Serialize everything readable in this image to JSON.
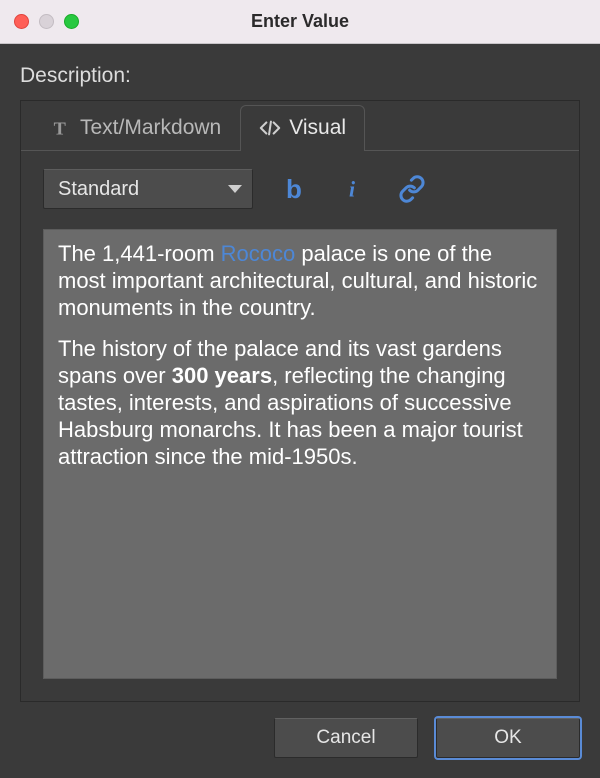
{
  "window": {
    "title": "Enter Value"
  },
  "form": {
    "label": "Description:"
  },
  "tabs": [
    {
      "id": "text",
      "label": "Text/Markdown",
      "active": false
    },
    {
      "id": "visual",
      "label": "Visual",
      "active": true
    }
  ],
  "toolbar": {
    "style_select": {
      "value": "Standard"
    },
    "buttons": [
      {
        "id": "bold",
        "glyph": "b"
      },
      {
        "id": "italic",
        "glyph": "i"
      },
      {
        "id": "link",
        "glyph": "link"
      }
    ]
  },
  "editor": {
    "paragraphs": [
      {
        "runs": [
          {
            "text": "The 1,441-room "
          },
          {
            "text": "Rococo",
            "link": true
          },
          {
            "text": " palace is one of the most important architectural, cultural, and historic monuments in the country."
          }
        ]
      },
      {
        "runs": [
          {
            "text": "The history of the palace and its vast gardens spans over "
          },
          {
            "text": "300 years",
            "bold": true
          },
          {
            "text": ", reflecting the changing tastes, interests, and aspirations of successive Habsburg monarchs. It has been a major tourist attraction since the mid-1950s."
          }
        ]
      }
    ]
  },
  "buttons": {
    "cancel": "Cancel",
    "ok": "OK"
  },
  "colors": {
    "accent": "#4d87d6"
  }
}
